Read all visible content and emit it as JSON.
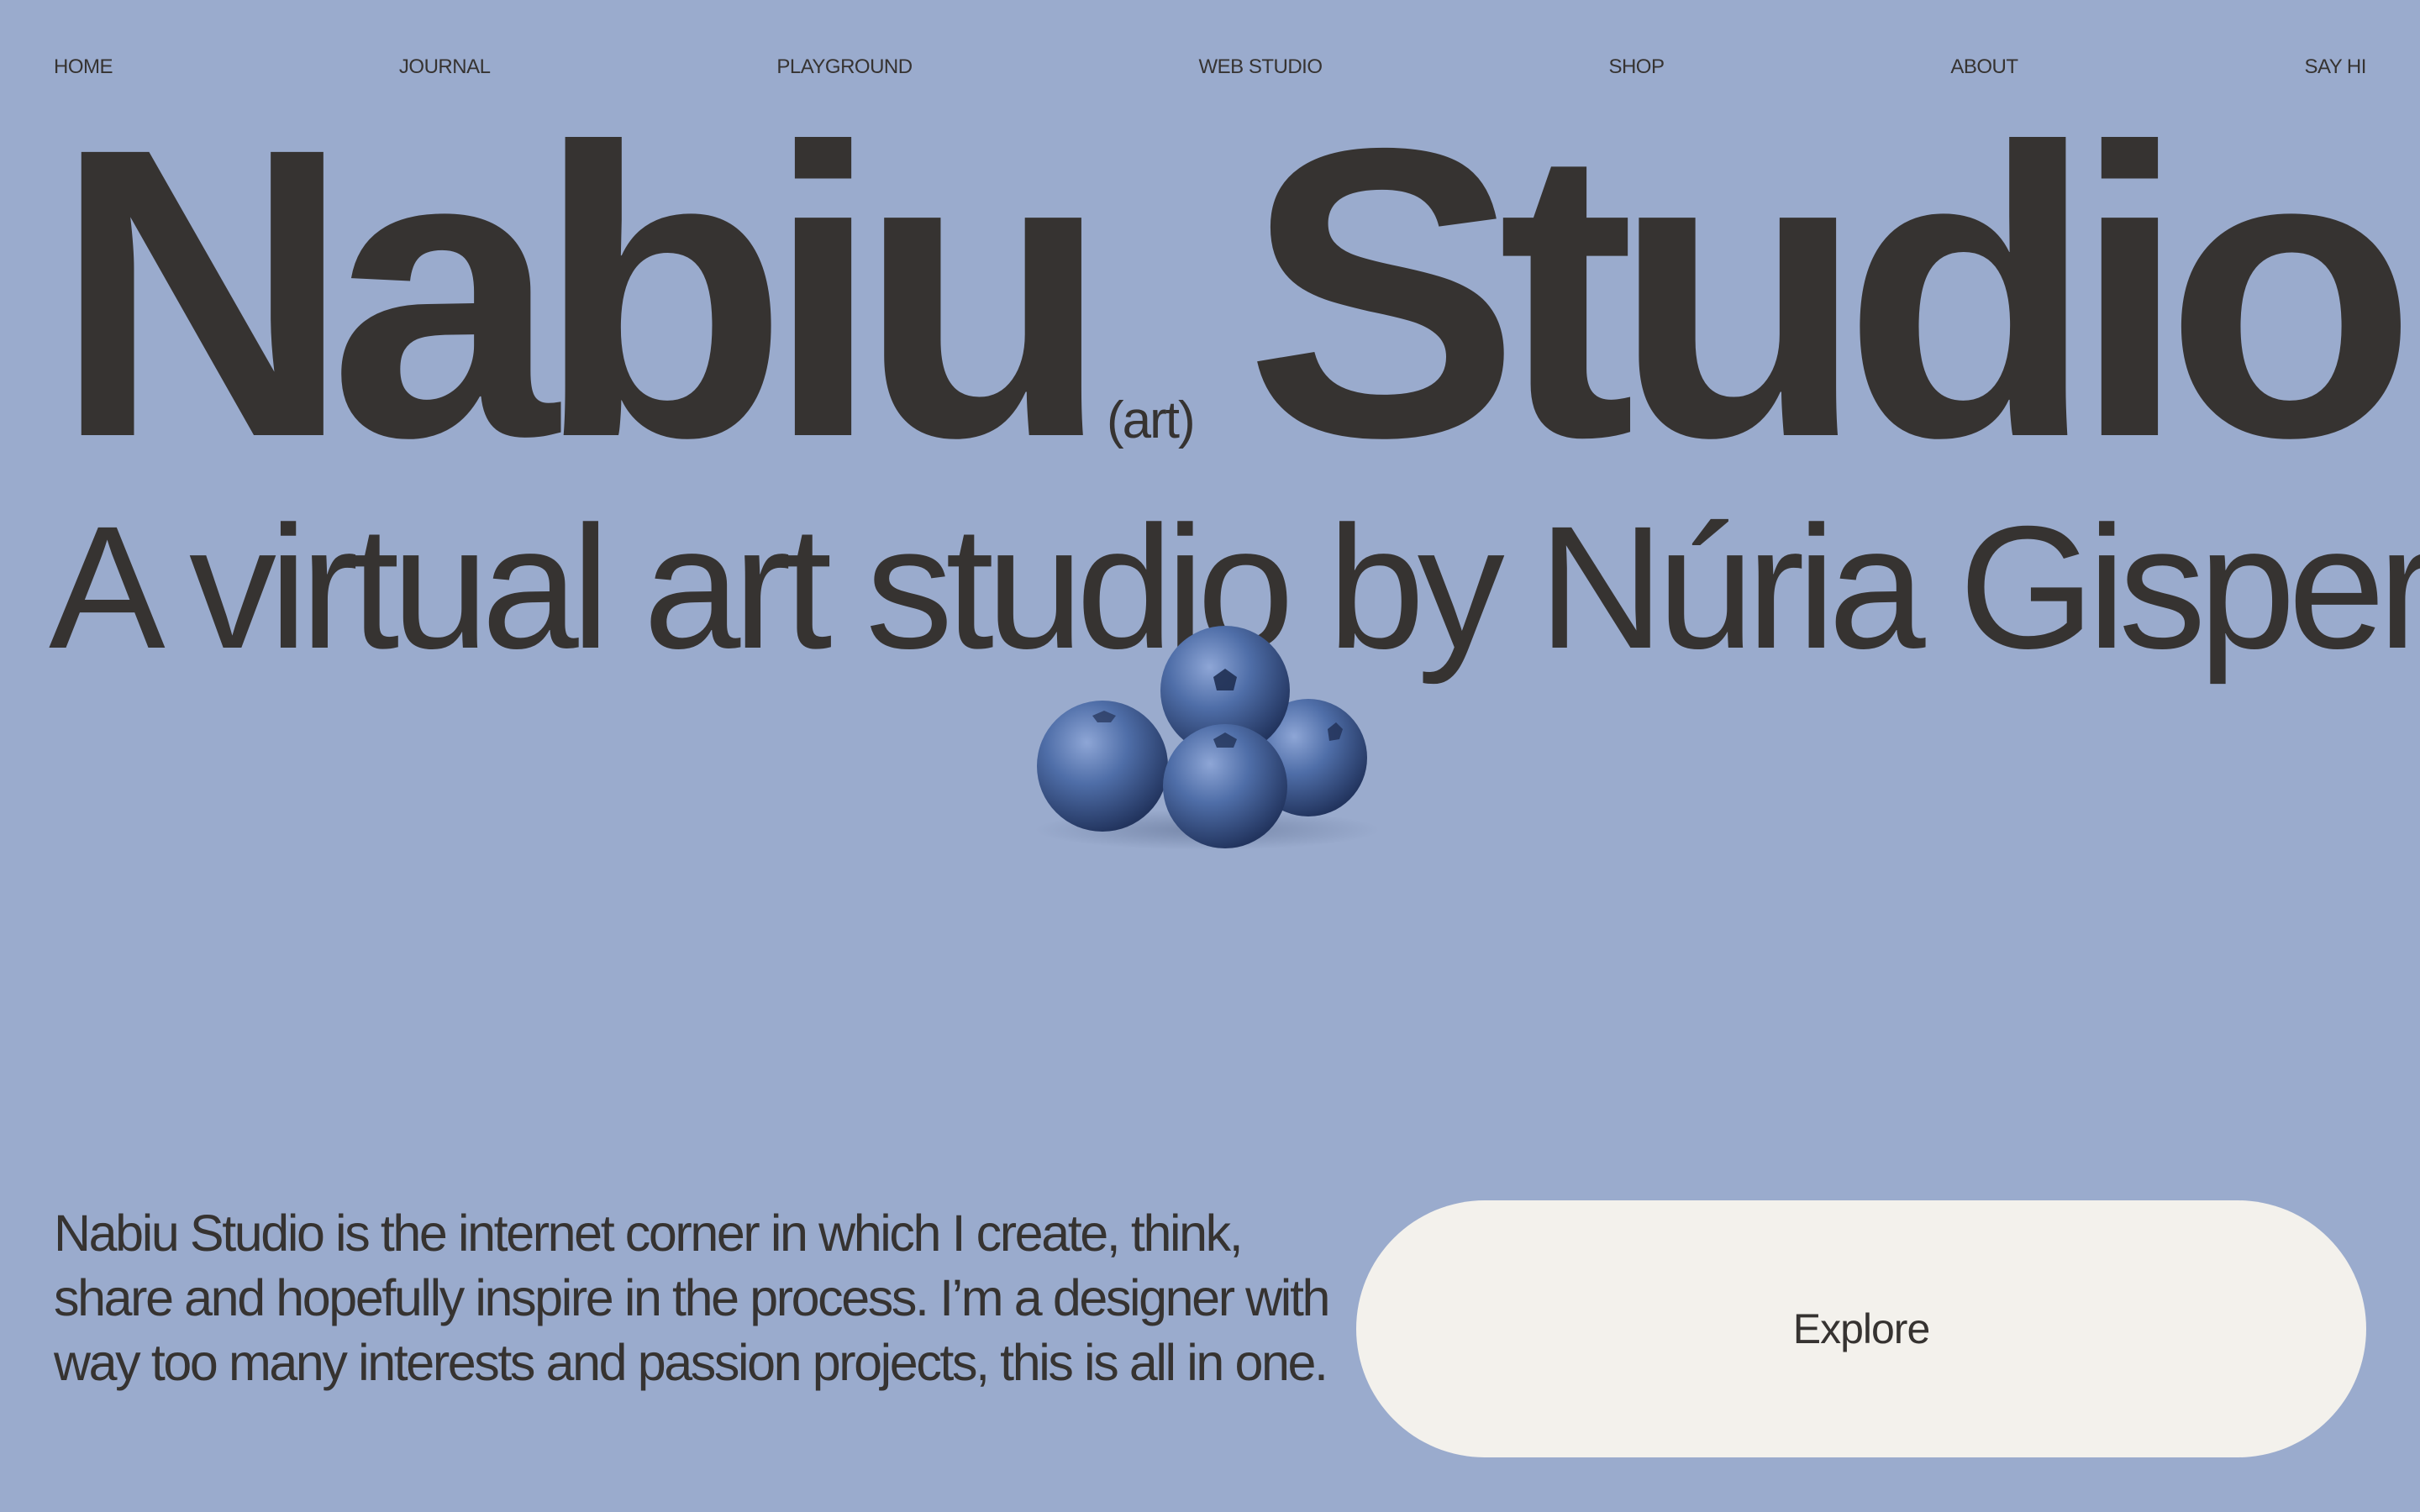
{
  "nav": {
    "items": [
      "HOME",
      "JOURNAL",
      "PLAYGROUND",
      "WEB STUDIO",
      "SHOP",
      "ABOUT",
      "SAY HI"
    ]
  },
  "hero": {
    "title_word_1": "Nabiu",
    "title_art": "(art)",
    "title_word_2": "Studio",
    "subtitle": "A virtual art studio by Núria Gispert"
  },
  "intro": {
    "text": "Nabiu Studio is the internet corner in which I create, think, share and hopefully inspire in the process. I’m a designer with way too many interests and passion projects, this is all in one."
  },
  "cta": {
    "label": "Explore"
  },
  "colors": {
    "background": "#9aabcd",
    "text": "#363331",
    "button_bg": "#f3f1ec",
    "berry": "#3f5d97"
  },
  "images": {
    "berries": "blueberries-image"
  }
}
